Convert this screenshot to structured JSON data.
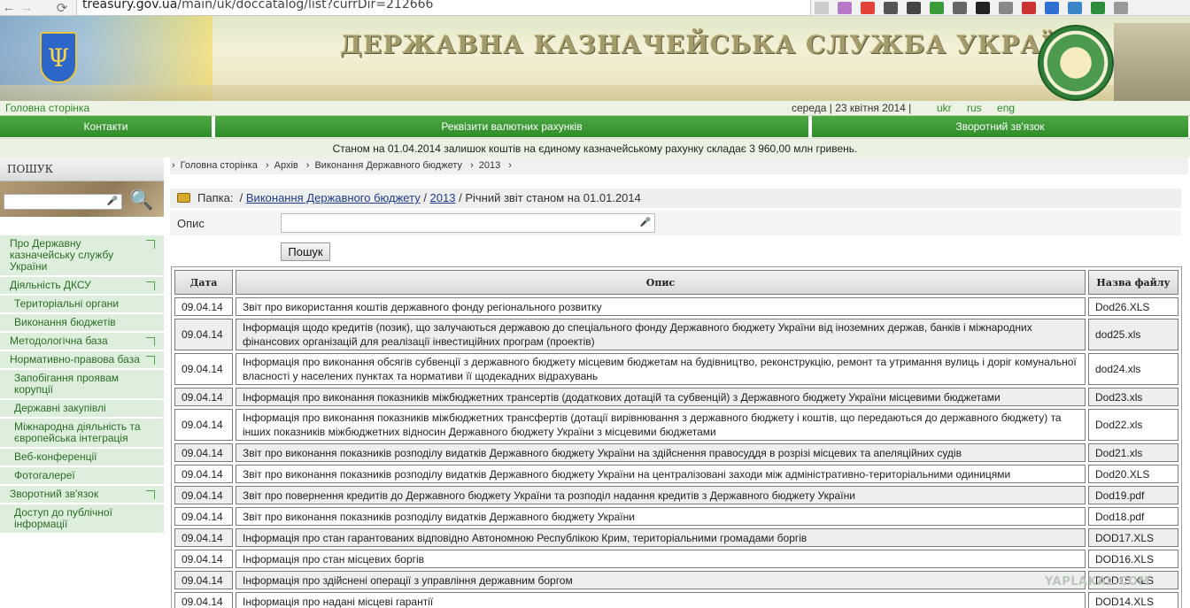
{
  "browser": {
    "back": "←",
    "forward": "→",
    "reload": "⟳",
    "url_domain": "treasury.gov.ua",
    "url_path": "/main/uk/doccatalog/list?currDir=212666"
  },
  "header": {
    "title": "ДЕРЖАВНА КАЗНАЧЕЙСЬКА СЛУЖБА УКРАЇНИ",
    "colors": {
      "green": "#2f8d2a",
      "blue": "#2d66c9",
      "gold": "#e9c640"
    }
  },
  "topline": {
    "home": "Головна сторінка",
    "date": "середа | 23 квітня 2014 |",
    "langs": [
      "ukr",
      "rus",
      "eng"
    ]
  },
  "nav": [
    "Контакти",
    "Реквізити валютних рахунків",
    "Зворотний зв'язок"
  ],
  "notice": "Станом на 01.04.2014 залишок коштів на єдиному казначейському рахунку складає 3 960,00 млн гривень.",
  "sidebar": {
    "search_title": "ПОШУК",
    "menu": [
      {
        "label": "Про Державну казначейську службу України",
        "sub": false,
        "corner": true
      },
      {
        "label": "Діяльність ДКСУ",
        "sub": false,
        "corner": true
      },
      {
        "label": "Територіальні органи",
        "sub": true,
        "corner": false
      },
      {
        "label": "Виконання бюджетів",
        "sub": true,
        "corner": false
      },
      {
        "label": "Методологічна база",
        "sub": false,
        "corner": true
      },
      {
        "label": "Нормативно-правова база",
        "sub": false,
        "corner": true
      },
      {
        "label": "Запобігання проявам корупції",
        "sub": true,
        "corner": false
      },
      {
        "label": "Державні закупівлі",
        "sub": true,
        "corner": false
      },
      {
        "label": "Міжнародна діяльність та європейська інтеграція",
        "sub": true,
        "corner": false
      },
      {
        "label": "Веб-конференції",
        "sub": true,
        "corner": false
      },
      {
        "label": "Фотогалереї",
        "sub": true,
        "corner": false
      },
      {
        "label": "Зворотний зв'язок",
        "sub": false,
        "corner": true
      },
      {
        "label": "Доступ до публічної інформації",
        "sub": true,
        "corner": false
      }
    ]
  },
  "breadcrumb": [
    "Головна сторінка",
    "Архів",
    "Виконання Державного бюджету",
    "2013"
  ],
  "folder": {
    "label": "Папка:",
    "link1": "Виконання Державного бюджету",
    "link2": "2013",
    "current": "Річний звіт станом на 01.01.2014"
  },
  "filter": {
    "label": "Опис",
    "button": "Пошук"
  },
  "table": {
    "headers": [
      "Дата",
      "Опис",
      "Назва файлу"
    ],
    "rows": [
      {
        "date": "09.04.14",
        "desc": "Звіт про використання коштів державного фонду регіонального розвитку",
        "file": "Dod26.XLS"
      },
      {
        "date": "09.04.14",
        "desc": "Інформація щодо кредитів (позик), що залучаються державою до спеціального фонду Державного бюджету України від іноземних держав, банків і міжнародних фінансових організацій для реалізації інвестиційних програм (проектів)",
        "file": "dod25.xls"
      },
      {
        "date": "09.04.14",
        "desc": "Інформація про виконання обсягів субвенції з державного бюджету місцевим бюджетам на будівництво, реконструкцію, ремонт та утримання вулиць і доріг комунальної власності у населених пунктах та нормативи її щодекадних відрахувань",
        "file": "dod24.xls"
      },
      {
        "date": "09.04.14",
        "desc": "Інформація про виконання показників міжбюджетних трансертів (додаткових дотацій та субвенцій) з Державного бюджету України місцевими бюджетами",
        "file": "Dod23.xls"
      },
      {
        "date": "09.04.14",
        "desc": "Інформація про виконання показників міжбюджетних трансфертів (дотації вирівнювання з державного бюджету і коштів, що передаються до державного бюджету) та інших показників міжбюджетних відносин Державного бюджету України з місцевими бюджетами",
        "file": "Dod22.xls"
      },
      {
        "date": "09.04.14",
        "desc": "Звіт про виконання показників розподілу видатків Державного бюджету України на здійснення правосуддя в розрізі місцевих та апеляційних судів",
        "file": "Dod21.xls"
      },
      {
        "date": "09.04.14",
        "desc": "Звіт про виконання показників розподілу видатків Державного бюджету України на централізовані заходи між адміністративно-територіальними одиницями",
        "file": "Dod20.XLS"
      },
      {
        "date": "09.04.14",
        "desc": "Звіт про повернення кредитів до Державного бюджету України та розподіл надання кредитів з Державного бюджету України",
        "file": "Dod19.pdf"
      },
      {
        "date": "09.04.14",
        "desc": "Звіт про виконання показників розподілу видатків Державного бюджету України",
        "file": "Dod18.pdf"
      },
      {
        "date": "09.04.14",
        "desc": "Інформація про стан гарантованих відповідно Автономною Республікою Крим, територіальними громадами боргів",
        "file": "DOD17.XLS"
      },
      {
        "date": "09.04.14",
        "desc": "Інформація про стан місцевих боргів",
        "file": "DOD16.XLS"
      },
      {
        "date": "09.04.14",
        "desc": "Інформація про здійснені операції з управління державним боргом",
        "file": "DOD15.XLS"
      },
      {
        "date": "09.04.14",
        "desc": "Інформація про надані місцеві гарантії",
        "file": "DOD14.XLS"
      }
    ]
  },
  "watermark": "YAPLAKAL.COM"
}
